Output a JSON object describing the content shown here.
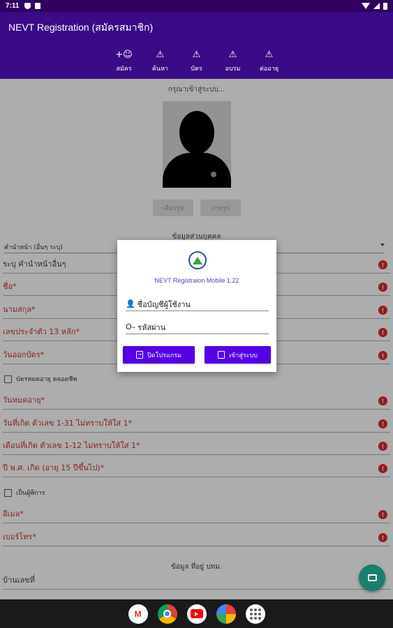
{
  "status": {
    "time": "7:11"
  },
  "app": {
    "title": "NEVT Registration (สมัครสมาชิก)"
  },
  "tabs": [
    {
      "label": "สมัคร",
      "icon": "person-add-icon"
    },
    {
      "label": "ค้นหา",
      "icon": "warning-icon"
    },
    {
      "label": "บัตร",
      "icon": "warning-icon"
    },
    {
      "label": "อบรม",
      "icon": "warning-icon"
    },
    {
      "label": "ต่ออายุ",
      "icon": "warning-icon"
    }
  ],
  "form": {
    "hint": "กรุณาเข้าสู่ระบบ...",
    "photo_buttons": {
      "choose": "เลือกรูป",
      "camera": "ถ่ายรูป"
    },
    "section_personal": "ข้อมูลส่วนบุคคล",
    "prefix_dropdown": "คำนำหน้า (อื่นๆ ระบุ)",
    "fields_a": [
      {
        "label": "ระบุ คำนำหน้าอื่นๆ",
        "required": false
      },
      {
        "label": "ชื่อ*",
        "required": true
      },
      {
        "label": "นามสกุล*",
        "required": true
      },
      {
        "label": "เลขประจำตัว 13 หลัก*",
        "required": true
      },
      {
        "label": "วันออกบัตร*",
        "required": true
      }
    ],
    "lifetime_checkbox": "บัตรหมดอายุ ตลอดชีพ",
    "fields_b": [
      {
        "label": "วันหมดอายุ*",
        "required": true
      },
      {
        "label": "วันที่เกิด ตัวเลข 1-31 ไม่ทราบให้ใส่ 1*",
        "required": true
      },
      {
        "label": "เดือนที่เกิด ตัวเลข 1-12 ไม่ทราบให้ใส่ 1*",
        "required": true
      },
      {
        "label": "ปี พ.ศ. เกิด (อายุ 15 ปีขึ้นไป)*",
        "required": true
      }
    ],
    "disabled_checkbox": "เป็นผู้พิการ",
    "fields_c": [
      {
        "label": "อีเมล*",
        "required": true
      },
      {
        "label": "เบอร์โทร*",
        "required": true
      }
    ],
    "section_address": "ข้อมูล ที่อยู่ บทม.",
    "address_field": "บ้านเลขที่"
  },
  "dialog": {
    "title": "NEVT Registraion Mobile 1.22",
    "username_placeholder": "ชื่อบัญชีผู้ใช้งาน",
    "password_placeholder": "รหัสผ่าน",
    "close_button": "ปิดโปรแกรม",
    "login_button": "เข้าสู่ระบบ"
  },
  "navbar": {
    "apps": [
      "gmail-icon",
      "chrome-icon",
      "youtube-icon",
      "photos-icon",
      "app-drawer-icon"
    ]
  },
  "colors": {
    "primary": "#3b0a86",
    "button": "#5500e6",
    "error": "#d32f2f",
    "fab": "#1a7f6e"
  }
}
